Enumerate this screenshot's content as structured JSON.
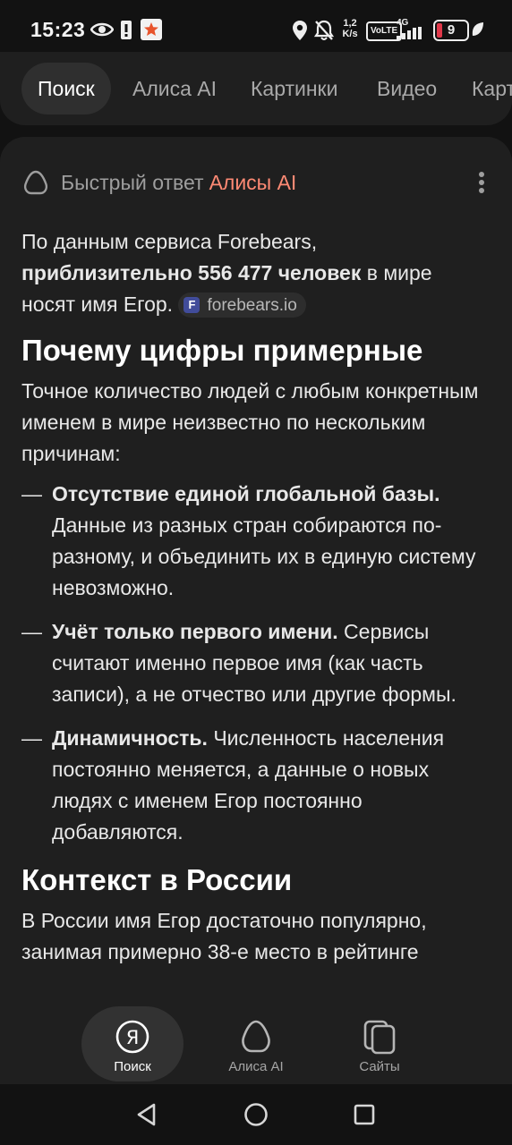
{
  "status_bar": {
    "time": "15:23",
    "net_speed_value": "1,2",
    "net_speed_unit": "K/s",
    "volte": "VoLTE",
    "network": "4G",
    "battery": "9",
    "icons": [
      "eye-icon",
      "alert-icon",
      "app-star-icon",
      "location-icon",
      "mute-bell-icon",
      "signal-icon",
      "battery-icon",
      "charging-leaf-icon"
    ]
  },
  "tabs": [
    {
      "label": "Поиск",
      "active": true
    },
    {
      "label": "Алиса AI",
      "active": false
    },
    {
      "label": "Картинки",
      "active": false
    },
    {
      "label": "Видео",
      "active": false
    },
    {
      "label": "Карт",
      "active": false
    }
  ],
  "answer": {
    "header_prefix": "Быстрый ответ",
    "header_accent": "Алисы AI",
    "intro_before": "По данным сервиса Forebears,",
    "intro_bold": "приблизительно 556 477 человек",
    "intro_after": "в мире носят имя Егор.",
    "source_label": "forebears.io",
    "source_letter": "F",
    "heading1": "Почему цифры примерные",
    "para1": "Точное количество людей с любым конкретным именем в мире неизвестно по нескольким причинам:",
    "list_dash": "—",
    "list": [
      {
        "bold": "Отсутствие единой глобальной базы.",
        "text": "Данные из разных стран собираются по-разному, и объединить их в единую систему невозможно."
      },
      {
        "bold": "Учёт только первого имени.",
        "text": "Сервисы считают именно первое имя (как часть записи), а не отчество или другие формы."
      },
      {
        "bold": "Динамичность.",
        "text": "Численность населения постоянно меняется, а данные о новых людях с именем Егор постоянно добавляются."
      }
    ],
    "heading2": "Контекст в России",
    "para2": "В России имя Егор достаточно популярно, занимая примерно 38-е место в рейтинге"
  },
  "bottom_nav": [
    {
      "label": "Поиск",
      "icon": "yandex-search-icon",
      "active": true,
      "glyph": "Я"
    },
    {
      "label": "Алиса AI",
      "icon": "alice-icon",
      "active": false
    },
    {
      "label": "Сайты",
      "icon": "sites-icon",
      "active": false
    }
  ],
  "colors": {
    "background": "#121212",
    "card": "#1f1f1f",
    "accent": "#ff8a74",
    "text": "#e8e8e8"
  }
}
